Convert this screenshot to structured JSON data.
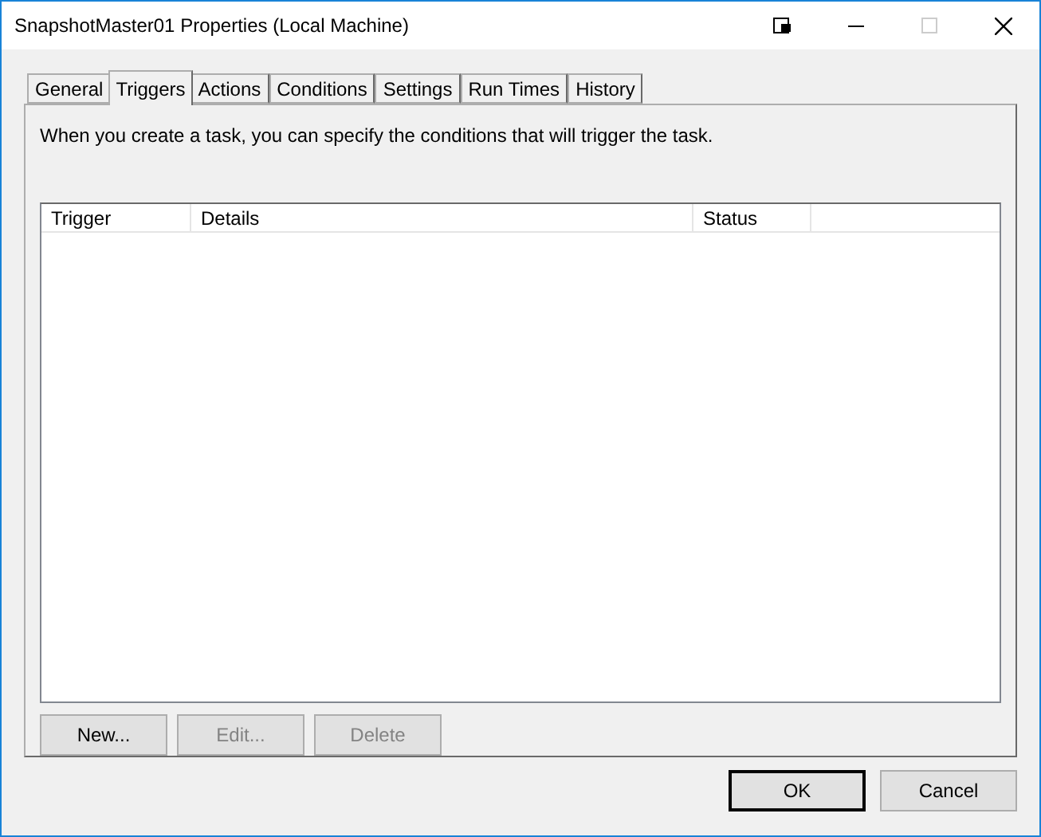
{
  "window": {
    "title": "SnapshotMaster01 Properties (Local Machine)"
  },
  "tabs": [
    {
      "label": "General",
      "selected": false
    },
    {
      "label": "Triggers",
      "selected": true
    },
    {
      "label": "Actions",
      "selected": false
    },
    {
      "label": "Conditions",
      "selected": false
    },
    {
      "label": "Settings",
      "selected": false
    },
    {
      "label": "Run Times",
      "selected": false
    },
    {
      "label": "History",
      "selected": false
    }
  ],
  "description": "When you create a task, you can specify the conditions that will trigger the task.",
  "table": {
    "columns": [
      "Trigger",
      "Details",
      "Status"
    ]
  },
  "panel_buttons": [
    {
      "label": "New...",
      "disabled": false
    },
    {
      "label": "Edit...",
      "disabled": true
    },
    {
      "label": "Delete",
      "disabled": true
    }
  ],
  "dialog_buttons": [
    {
      "label": "OK",
      "default": true
    },
    {
      "label": "Cancel",
      "default": false
    }
  ]
}
